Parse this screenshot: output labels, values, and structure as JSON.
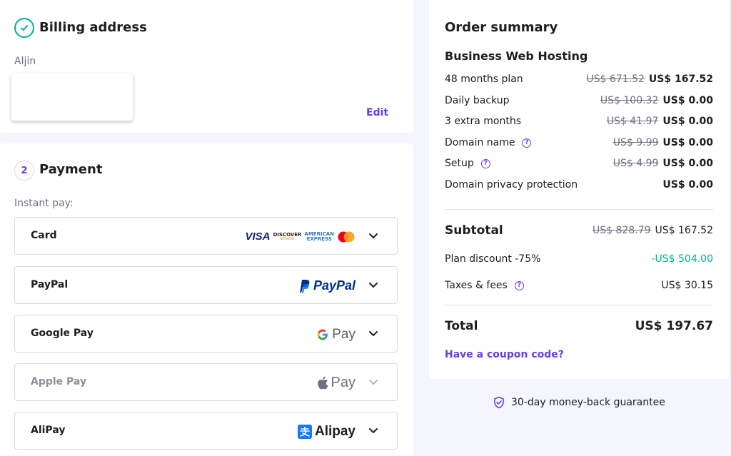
{
  "billing": {
    "title": "Billing address",
    "name": "Aljin",
    "edit_label": "Edit"
  },
  "payment": {
    "step": "2",
    "title": "Payment",
    "instant_label": "Instant pay:",
    "methods": [
      {
        "label": "Card",
        "disabled": false,
        "logos": [
          "VISA",
          "DISCOVER",
          "AMERICAN EXPRESS",
          "mastercard"
        ]
      },
      {
        "label": "PayPal",
        "disabled": false,
        "logo_text": "PayPal"
      },
      {
        "label": "Google Pay",
        "disabled": false,
        "logo_text": "Pay"
      },
      {
        "label": "Apple Pay",
        "disabled": true,
        "logo_text": "Pay"
      },
      {
        "label": "AliPay",
        "disabled": false,
        "logo_text": "Alipay"
      }
    ],
    "card_logos": {
      "visa": "VISA",
      "discover": "DISCOVER",
      "discover_sub": "NETWORK",
      "amex_top": "AMERICAN",
      "amex_bottom": "EXPRESS"
    }
  },
  "summary": {
    "title": "Order summary",
    "product": "Business Web Hosting",
    "items": [
      {
        "label": "48 months plan",
        "old": "US$ 671.52",
        "price": "US$ 167.52",
        "help": false
      },
      {
        "label": "Daily backup",
        "old": "US$ 100.32",
        "price": "US$ 0.00",
        "help": false
      },
      {
        "label": "3 extra months",
        "old": "US$ 41.97",
        "price": "US$ 0.00",
        "help": false
      },
      {
        "label": "Domain name",
        "old": "US$ 9.99",
        "price": "US$ 0.00",
        "help": true
      },
      {
        "label": "Setup",
        "old": "US$ 4.99",
        "price": "US$ 0.00",
        "help": true
      },
      {
        "label": "Domain privacy protection",
        "old": "",
        "price": "US$ 0.00",
        "help": false
      }
    ],
    "subtotal_label": "Subtotal",
    "subtotal_old": "US$ 828.79",
    "subtotal": "US$ 167.52",
    "discount_label": "Plan discount -75%",
    "discount": "-US$ 504.00",
    "taxes_label": "Taxes & fees",
    "taxes": "US$ 30.15",
    "total_label": "Total",
    "total": "US$ 197.67",
    "coupon": "Have a coupon code?",
    "guarantee": "30-day money-back guarantee"
  },
  "colors": {
    "accent": "#673de6",
    "success": "#00b090",
    "background": "#f4f5ff"
  }
}
